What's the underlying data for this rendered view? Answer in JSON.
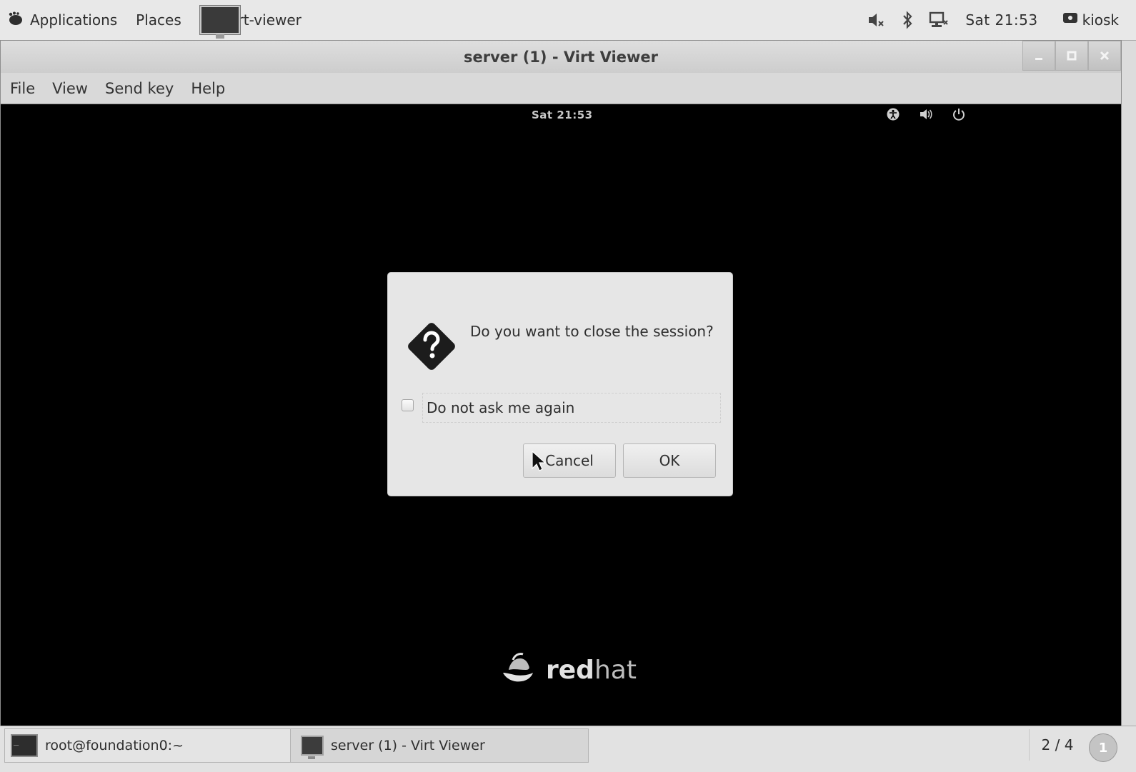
{
  "top_panel": {
    "applications": "Applications",
    "places": "Places",
    "task": "Virt-viewer",
    "clock": "Sat 21:53",
    "user": "kiosk"
  },
  "window": {
    "title": "server (1) - Virt Viewer",
    "menu": [
      "File",
      "View",
      "Send key",
      "Help"
    ]
  },
  "guest": {
    "clock": "Sat 21:53",
    "logo": {
      "bold": "red",
      "light": "hat"
    }
  },
  "dialog": {
    "message": "Do you want to close the session?",
    "checkbox_label": "Do not ask me again",
    "checkbox_checked": false,
    "cancel_label": "Cancel",
    "ok_label": "OK"
  },
  "bottom_panel": {
    "tasks": [
      "root@foundation0:~",
      "server (1) - Virt Viewer"
    ],
    "workspace": "2 / 4",
    "notification_count": "1"
  }
}
